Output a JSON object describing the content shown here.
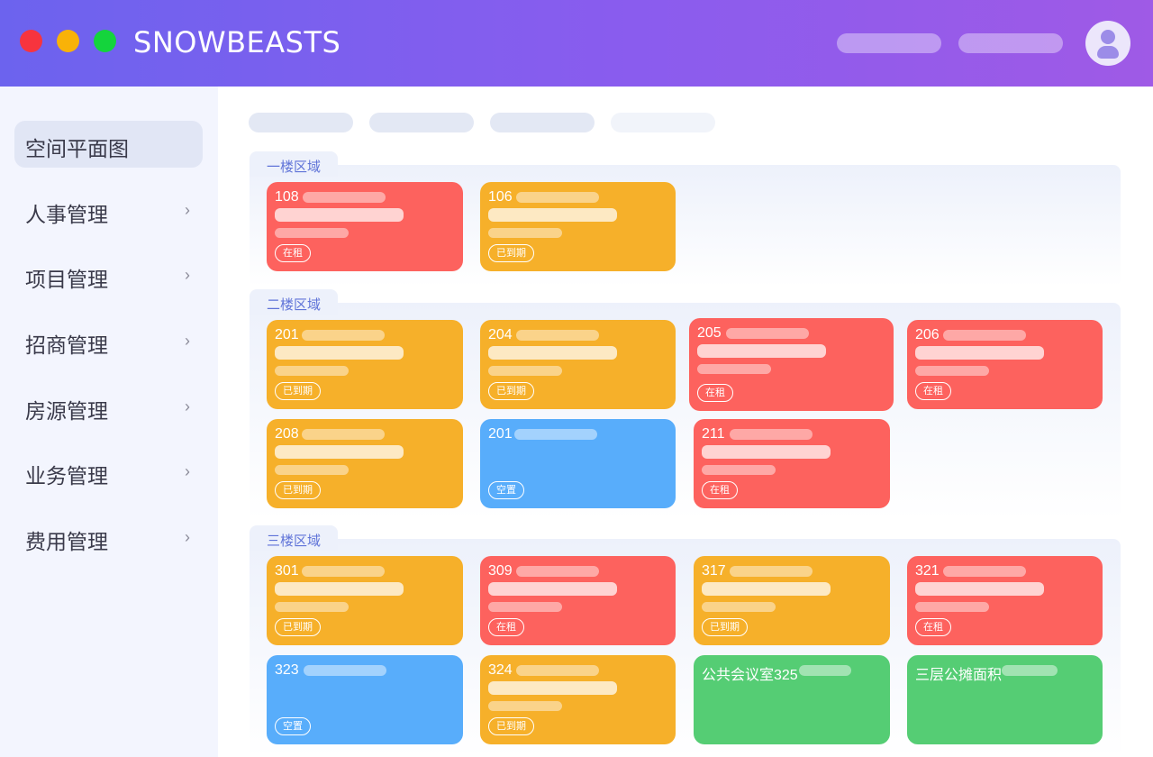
{
  "header": {
    "brand": "SNOWBEASTS",
    "colors": {
      "gradient_start": "#6c63ee",
      "gradient_end": "#9f5ae6"
    },
    "window_dots": [
      "red",
      "yellow",
      "green"
    ],
    "avatar_icon": "user-avatar-icon"
  },
  "sidebar": {
    "items": [
      {
        "label": "空间平面图",
        "active": true
      },
      {
        "label": "人事管理",
        "chevron": "›"
      },
      {
        "label": "项目管理",
        "chevron": "›"
      },
      {
        "label": "招商管理",
        "chevron": "›"
      },
      {
        "label": "房源管理",
        "chevron": "›"
      },
      {
        "label": "业务管理",
        "chevron": "›"
      },
      {
        "label": "费用管理",
        "chevron": "›"
      }
    ]
  },
  "status_colors": {
    "在租": "#fd625e",
    "已到期": "#f6b02a",
    "空置": "#58adfb",
    "公共": "#55cd74"
  },
  "zones": [
    {
      "title": "一楼区域",
      "rooms": [
        {
          "name": "108",
          "status": "在租"
        },
        {
          "name": "106",
          "status": "已到期"
        }
      ]
    },
    {
      "title": "二楼区域",
      "rooms": [
        {
          "name": "201",
          "status": "已到期"
        },
        {
          "name": "204",
          "status": "已到期"
        },
        {
          "name": "205",
          "status": "在租"
        },
        {
          "name": "206",
          "status": "在租"
        },
        {
          "name": "208",
          "status": "已到期"
        },
        {
          "name": "201",
          "status": "空置"
        },
        {
          "name": "211",
          "status": "在租"
        }
      ]
    },
    {
      "title": "三楼区域",
      "rooms": [
        {
          "name": "301",
          "status": "已到期"
        },
        {
          "name": "309",
          "status": "在租"
        },
        {
          "name": "317",
          "status": "已到期"
        },
        {
          "name": "321",
          "status": "在租"
        },
        {
          "name": "323",
          "status": "空置"
        },
        {
          "name": "324",
          "status": "已到期"
        },
        {
          "name": "公共会议室325",
          "status": ""
        },
        {
          "name": "三层公摊面积",
          "status": ""
        }
      ]
    }
  ]
}
